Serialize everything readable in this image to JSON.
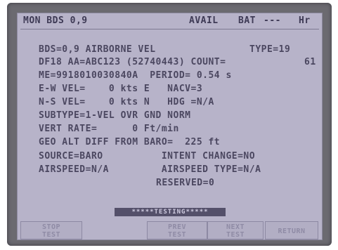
{
  "header": {
    "mode": "MON BDS 0,9",
    "avail": "AVAIL",
    "battery": "BAT",
    "battery_value": "---",
    "battery_unit": "Hr"
  },
  "lines": [
    {
      "id": "bds",
      "text": "BDS=0,9 AIRBORNE VEL",
      "right": "TYPE=19"
    },
    {
      "id": "df",
      "text": "DF18 AA=ABC123 (52740443) COUNT=",
      "right": "61"
    },
    {
      "id": "me",
      "text": "ME=9918010030840A  PERIOD= 0.54 s",
      "right": ""
    },
    {
      "id": "ew",
      "text": "E-W VEL=    0 kts E   NACV=3",
      "right": ""
    },
    {
      "id": "ns",
      "text": "N-S VEL=    0 kts N   HDG =N/A",
      "right": ""
    },
    {
      "id": "subtype",
      "text": "SUBTYPE=1-VEL OVR GND NORM",
      "right": ""
    },
    {
      "id": "vert",
      "text": "VERT RATE=      0 Ft/min",
      "right": ""
    },
    {
      "id": "geo",
      "text": "GEO ALT DIFF FROM BARO=  225 ft",
      "right": ""
    },
    {
      "id": "source",
      "text": "SOURCE=BARO          INTENT CHANGE=NO",
      "right": ""
    },
    {
      "id": "airspeed",
      "text": "AIRSPEED=N/A         AIRSPEED TYPE=N/A",
      "right": ""
    },
    {
      "id": "reserved",
      "text": "RESERVED=0",
      "right": ""
    }
  ],
  "status_text": "*****TESTING*****",
  "softkeys": [
    {
      "line1": "STOP",
      "line2": "TEST"
    },
    {
      "line1": "PREV",
      "line2": "TEST"
    },
    {
      "line1": "NEXT",
      "line2": "TEST"
    },
    {
      "line1": "RETURN",
      "line2": ""
    }
  ]
}
